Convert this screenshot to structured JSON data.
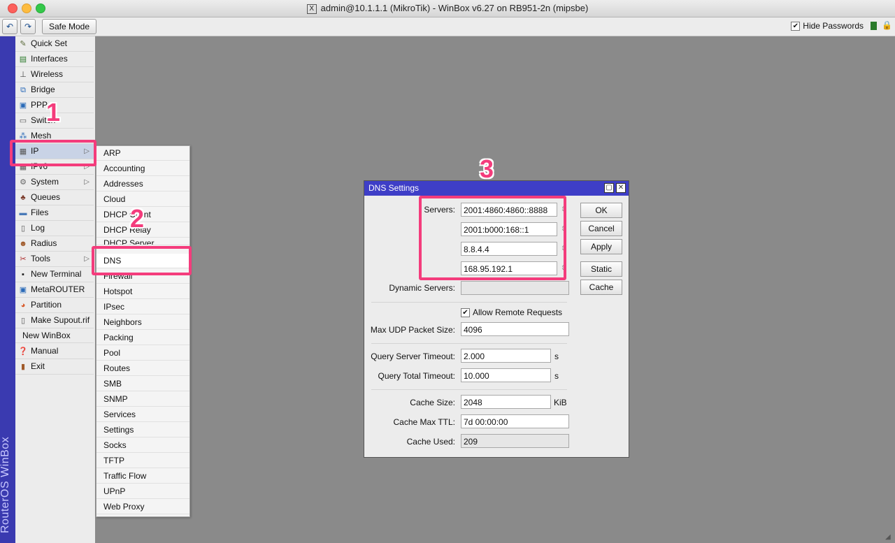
{
  "window": {
    "title": "admin@10.1.1.1 (MikroTik) - WinBox v6.27 on RB951-2n (mipsbe)"
  },
  "toolbar": {
    "undo_icon": "undo-icon",
    "redo_icon": "redo-icon",
    "safe_mode_label": "Safe Mode",
    "hide_passwords_label": "Hide Passwords",
    "hide_passwords_checked": true
  },
  "sidebar": {
    "brand": "RouterOS WinBox",
    "items": [
      {
        "label": "Quick Set",
        "icon": "quickset-icon"
      },
      {
        "label": "Interfaces",
        "icon": "interfaces-icon"
      },
      {
        "label": "Wireless",
        "icon": "wireless-icon"
      },
      {
        "label": "Bridge",
        "icon": "bridge-icon"
      },
      {
        "label": "PPP",
        "icon": "ppp-icon"
      },
      {
        "label": "Switch",
        "icon": "switch-icon"
      },
      {
        "label": "Mesh",
        "icon": "mesh-icon"
      },
      {
        "label": "IP",
        "icon": "ip-icon",
        "has_submenu": true
      },
      {
        "label": "IPv6",
        "icon": "ipv6-icon",
        "has_submenu": true
      },
      {
        "label": "System",
        "icon": "system-icon",
        "has_submenu": true
      },
      {
        "label": "Queues",
        "icon": "queues-icon"
      },
      {
        "label": "Files",
        "icon": "files-icon"
      },
      {
        "label": "Log",
        "icon": "log-icon"
      },
      {
        "label": "Radius",
        "icon": "radius-icon"
      },
      {
        "label": "Tools",
        "icon": "tools-icon",
        "has_submenu": true
      },
      {
        "label": "New Terminal",
        "icon": "terminal-icon"
      },
      {
        "label": "MetaROUTER",
        "icon": "metarouter-icon"
      },
      {
        "label": "Partition",
        "icon": "partition-icon"
      },
      {
        "label": "Make Supout.rif",
        "icon": "supout-icon"
      },
      {
        "label": "New WinBox",
        "icon": ""
      },
      {
        "label": "Manual",
        "icon": "manual-icon"
      },
      {
        "label": "Exit",
        "icon": "exit-icon"
      }
    ]
  },
  "submenu": {
    "items": [
      "ARP",
      "Accounting",
      "Addresses",
      "Cloud",
      "DHCP Client",
      "DHCP Relay",
      "DHCP Server",
      "DNS",
      "Firewall",
      "Hotspot",
      "IPsec",
      "Neighbors",
      "Packing",
      "Pool",
      "Routes",
      "SMB",
      "SNMP",
      "Services",
      "Settings",
      "Socks",
      "TFTP",
      "Traffic Flow",
      "UPnP",
      "Web Proxy"
    ]
  },
  "annotations": {
    "step1": "1",
    "step2": "2",
    "step3": "3",
    "accent": "#f43c7c"
  },
  "dns_dialog": {
    "title": "DNS Settings",
    "servers_label": "Servers:",
    "servers": [
      "2001:4860:4860::8888",
      "2001:b000:168::1",
      "8.8.4.4",
      "168.95.192.1"
    ],
    "dynamic_servers_label": "Dynamic Servers:",
    "dynamic_servers_value": "",
    "allow_remote_label": "Allow Remote Requests",
    "allow_remote_checked": true,
    "max_udp_label": "Max UDP Packet Size:",
    "max_udp_value": "4096",
    "query_server_timeout_label": "Query Server Timeout:",
    "query_server_timeout_value": "2.000",
    "query_server_timeout_unit": "s",
    "query_total_timeout_label": "Query Total Timeout:",
    "query_total_timeout_value": "10.000",
    "query_total_timeout_unit": "s",
    "cache_size_label": "Cache Size:",
    "cache_size_value": "2048",
    "cache_size_unit": "KiB",
    "cache_max_ttl_label": "Cache Max TTL:",
    "cache_max_ttl_value": "7d 00:00:00",
    "cache_used_label": "Cache Used:",
    "cache_used_value": "209",
    "buttons": {
      "ok": "OK",
      "cancel": "Cancel",
      "apply": "Apply",
      "static": "Static",
      "cache": "Cache"
    }
  }
}
